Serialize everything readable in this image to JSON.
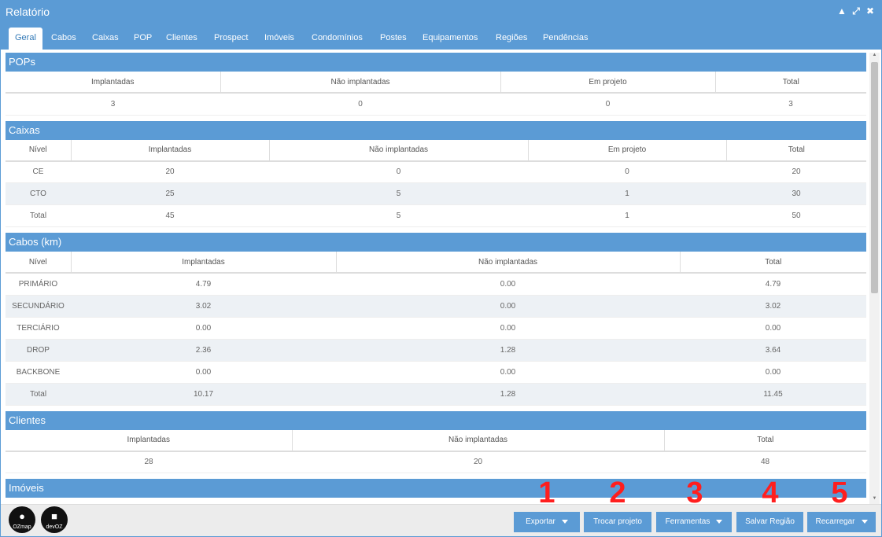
{
  "window": {
    "title": "Relatório"
  },
  "tabs": [
    "Geral",
    "Cabos",
    "Caixas",
    "POP",
    "Clientes",
    "Prospect",
    "Imóveis",
    "Condomínios",
    "Postes",
    "Equipamentos",
    "Regiões",
    "Pendências"
  ],
  "pops": {
    "title": "POPs",
    "headers": [
      "Implantadas",
      "Não implantadas",
      "Em projeto",
      "Total"
    ],
    "values": [
      "3",
      "0",
      "0",
      "3"
    ]
  },
  "caixas": {
    "title": "Caixas",
    "headers": [
      "Nível",
      "Implantadas",
      "Não implantadas",
      "Em projeto",
      "Total"
    ],
    "rows": [
      [
        "CE",
        "20",
        "0",
        "0",
        "20"
      ],
      [
        "CTO",
        "25",
        "5",
        "1",
        "30"
      ],
      [
        "Total",
        "45",
        "5",
        "1",
        "50"
      ]
    ]
  },
  "cabos": {
    "title": "Cabos (km)",
    "headers": [
      "Nível",
      "Implantadas",
      "Não implantadas",
      "Total"
    ],
    "rows": [
      [
        "PRIMÁRIO",
        "4.79",
        "0.00",
        "4.79"
      ],
      [
        "SECUNDÁRIO",
        "3.02",
        "0.00",
        "3.02"
      ],
      [
        "TERCIÁRIO",
        "0.00",
        "0.00",
        "0.00"
      ],
      [
        "DROP",
        "2.36",
        "1.28",
        "3.64"
      ],
      [
        "BACKBONE",
        "0.00",
        "0.00",
        "0.00"
      ],
      [
        "Total",
        "10.17",
        "1.28",
        "11.45"
      ]
    ]
  },
  "clientes": {
    "title": "Clientes",
    "headers": [
      "Implantadas",
      "Não implantadas",
      "Total"
    ],
    "values": [
      "28",
      "20",
      "48"
    ]
  },
  "imoveis": {
    "title": "Imóveis"
  },
  "logos": {
    "ozmap": "OZmap",
    "devoz": "devOZ"
  },
  "icons": {
    "minimize": "chevron-up-icon",
    "maximize": "expand-icon",
    "close": "close-icon",
    "ozmap": "map-pin-icon",
    "devoz": "cube-icon"
  },
  "footer": {
    "buttons": [
      "Exportar",
      "Trocar projeto",
      "Ferramentas",
      "Salvar Região",
      "Recarregar"
    ]
  },
  "annotations": [
    "1",
    "2",
    "3",
    "4",
    "5"
  ],
  "colors": {
    "primary": "#5b9bd5",
    "annotation": "#ff1e1e",
    "stripe": "#edf1f5"
  }
}
